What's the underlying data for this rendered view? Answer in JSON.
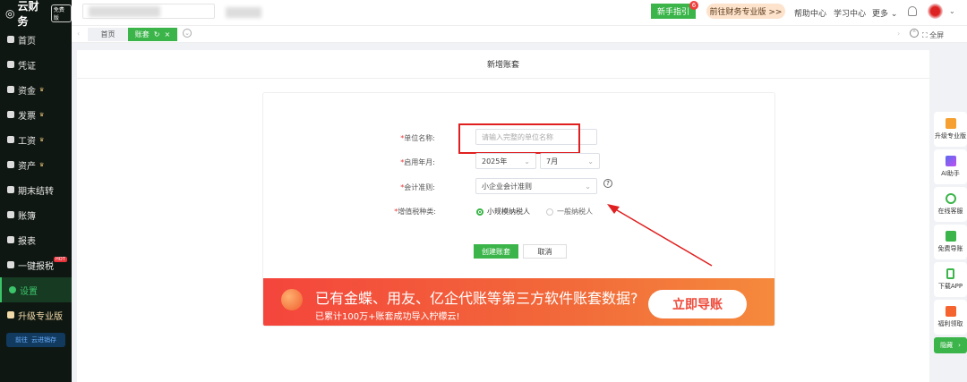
{
  "sidebar": {
    "logo": "云财务",
    "edition": "免费版",
    "items": [
      {
        "label": "首页"
      },
      {
        "label": "凭证"
      },
      {
        "label": "资金",
        "crown": true
      },
      {
        "label": "发票",
        "crown": true
      },
      {
        "label": "工资",
        "crown": true
      },
      {
        "label": "资产",
        "crown": true
      },
      {
        "label": "期末结转"
      },
      {
        "label": "账簿"
      },
      {
        "label": "报表"
      },
      {
        "label": "一键报税",
        "badge": "HOT"
      },
      {
        "label": "设置",
        "active": true
      },
      {
        "label": "升级专业版"
      }
    ],
    "jxc_prefix": "前往",
    "jxc_label": "云进销存"
  },
  "topbar": {
    "guide": "新手指引",
    "guide_count": "6",
    "pro": "前往财务专业版 >>",
    "help": "帮助中心",
    "learn": "学习中心",
    "more": "更多"
  },
  "tabs": {
    "home": "首页",
    "account": "账套",
    "fullscreen": "全屏"
  },
  "page": {
    "title": "新增账套"
  },
  "form": {
    "unit_label": "单位名称:",
    "unit_placeholder": "请输入完整的单位名称",
    "date_label": "启用年月:",
    "year": "2025年",
    "month": "7月",
    "standard_label": "会计准则:",
    "standard": "小企业会计准则",
    "vat_label": "增值税种类:",
    "vat_options": [
      "小规模纳税人",
      "一般纳税人"
    ],
    "create": "创建账套",
    "cancel": "取消"
  },
  "banner": {
    "title": "已有金蝶、用友、亿企代账等第三方软件账套数据?",
    "subtitle": "已累计100万+账套成功导入柠檬云!",
    "button": "立即导账"
  },
  "right_panel": {
    "items": [
      "升级专业版",
      "AI助手",
      "在线客服",
      "免费导账",
      "下载APP",
      "福利领取"
    ],
    "hide": "隐藏"
  },
  "colors": {
    "accent": "#3bb54a",
    "highlight": "#e02020"
  }
}
